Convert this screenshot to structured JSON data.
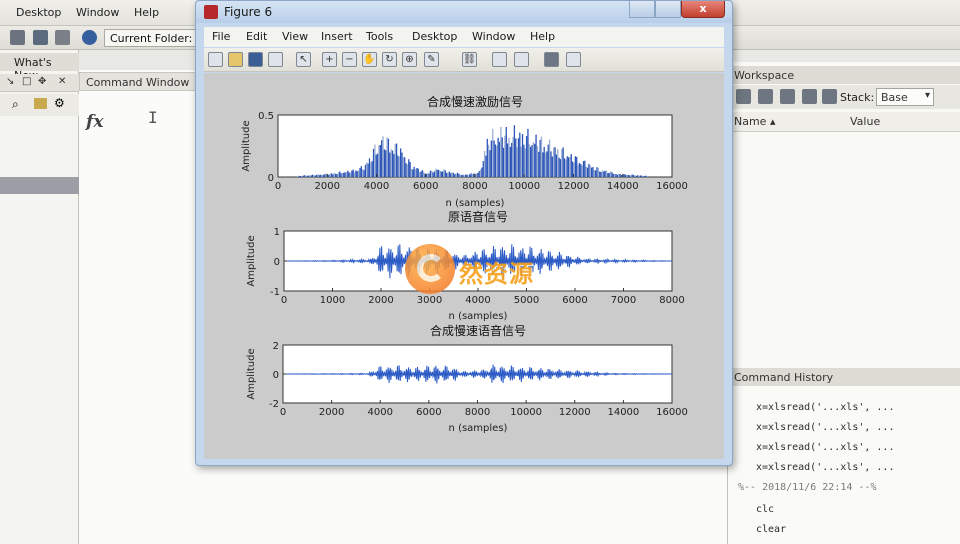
{
  "desktop": {
    "menu": [
      "Desktop",
      "Window",
      "Help"
    ],
    "current_folder_label": "Current Folder:",
    "whats_new": "What's New",
    "command_window_title": "Command Window",
    "prompt_symbol": "fx",
    "workspace": {
      "title": "Workspace",
      "stack_label": "Stack:",
      "stack_value": "Base",
      "columns": [
        "Name ▴",
        "Value"
      ]
    },
    "command_history": {
      "title": "Command History",
      "lines": [
        "x=xlsread('...xls', ...",
        "x=xlsread('...xls', ...",
        "x=xlsread('...xls', ...",
        "x=xlsread('...xls', ...",
        "%-- 2018/11/6 22:14 --%",
        "clc",
        "clear"
      ]
    }
  },
  "figure": {
    "title": "Figure 6",
    "close_label": "x",
    "menu": [
      "File",
      "Edit",
      "View",
      "Insert",
      "Tools",
      "Desktop",
      "Window",
      "Help"
    ]
  },
  "watermark_text": "然资源",
  "chart_data": [
    {
      "type": "bar",
      "title": "合成慢速激励信号",
      "xlabel": "n (samples)",
      "ylabel": "Amplitude",
      "xlim": [
        0,
        16000
      ],
      "ylim": [
        0,
        0.5
      ],
      "xticks": [
        0,
        2000,
        4000,
        6000,
        8000,
        10000,
        12000,
        14000,
        16000
      ],
      "yticks": [
        0,
        0.5
      ],
      "envelope": [
        {
          "x": 800,
          "y": 0.01
        },
        {
          "x": 2000,
          "y": 0.03
        },
        {
          "x": 3000,
          "y": 0.06
        },
        {
          "x": 3500,
          "y": 0.1
        },
        {
          "x": 3800,
          "y": 0.22
        },
        {
          "x": 4200,
          "y": 0.38
        },
        {
          "x": 4600,
          "y": 0.33
        },
        {
          "x": 5000,
          "y": 0.26
        },
        {
          "x": 5400,
          "y": 0.12
        },
        {
          "x": 6000,
          "y": 0.04
        },
        {
          "x": 6500,
          "y": 0.08
        },
        {
          "x": 7000,
          "y": 0.05
        },
        {
          "x": 7600,
          "y": 0.02
        },
        {
          "x": 8200,
          "y": 0.05
        },
        {
          "x": 8500,
          "y": 0.36
        },
        {
          "x": 9000,
          "y": 0.43
        },
        {
          "x": 9800,
          "y": 0.42
        },
        {
          "x": 10600,
          "y": 0.36
        },
        {
          "x": 11400,
          "y": 0.27
        },
        {
          "x": 12200,
          "y": 0.17
        },
        {
          "x": 13000,
          "y": 0.08
        },
        {
          "x": 13800,
          "y": 0.03
        },
        {
          "x": 15000,
          "y": 0.01
        }
      ]
    },
    {
      "type": "line",
      "title": "原语音信号",
      "xlabel": "n (samples)",
      "ylabel": "Amplitude",
      "xlim": [
        0,
        8000
      ],
      "ylim": [
        -1,
        1
      ],
      "xticks": [
        0,
        1000,
        2000,
        3000,
        4000,
        5000,
        6000,
        7000,
        8000
      ],
      "yticks": [
        -1,
        0,
        1
      ],
      "envelope": [
        {
          "x": 0,
          "y": 0.0
        },
        {
          "x": 1000,
          "y": 0.02
        },
        {
          "x": 1800,
          "y": 0.08
        },
        {
          "x": 2000,
          "y": 0.55
        },
        {
          "x": 2400,
          "y": 0.6
        },
        {
          "x": 2800,
          "y": 0.5
        },
        {
          "x": 3300,
          "y": 0.42
        },
        {
          "x": 3700,
          "y": 0.2
        },
        {
          "x": 4100,
          "y": 0.45
        },
        {
          "x": 4500,
          "y": 0.6
        },
        {
          "x": 5000,
          "y": 0.55
        },
        {
          "x": 5600,
          "y": 0.35
        },
        {
          "x": 6200,
          "y": 0.08
        },
        {
          "x": 8000,
          "y": 0.0
        }
      ]
    },
    {
      "type": "line",
      "title": "合成慢速语音信号",
      "xlabel": "n (samples)",
      "ylabel": "Amplitude",
      "xlim": [
        0,
        16000
      ],
      "ylim": [
        -2,
        2
      ],
      "xticks": [
        0,
        2000,
        4000,
        6000,
        8000,
        10000,
        12000,
        14000,
        16000
      ],
      "yticks": [
        -2,
        0,
        2
      ],
      "envelope": [
        {
          "x": 0,
          "y": 0.0
        },
        {
          "x": 3500,
          "y": 0.05
        },
        {
          "x": 4000,
          "y": 0.6
        },
        {
          "x": 4800,
          "y": 0.65
        },
        {
          "x": 5400,
          "y": 0.5
        },
        {
          "x": 6200,
          "y": 0.7
        },
        {
          "x": 7000,
          "y": 0.55
        },
        {
          "x": 7400,
          "y": 0.2
        },
        {
          "x": 8300,
          "y": 0.35
        },
        {
          "x": 8600,
          "y": 0.7
        },
        {
          "x": 9500,
          "y": 0.6
        },
        {
          "x": 11000,
          "y": 0.4
        },
        {
          "x": 12500,
          "y": 0.2
        },
        {
          "x": 13500,
          "y": 0.05
        },
        {
          "x": 16000,
          "y": 0.0
        }
      ]
    }
  ]
}
